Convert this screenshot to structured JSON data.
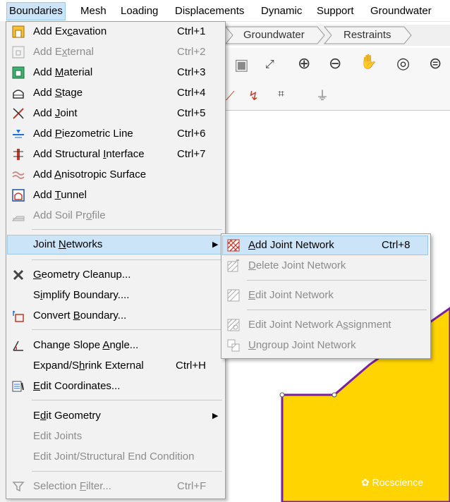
{
  "menubar": {
    "items": [
      "Boundaries",
      "Mesh",
      "Loading",
      "Displacements",
      "Dynamic",
      "Support",
      "Groundwater"
    ]
  },
  "workflow_tabs": [
    "Groundwater",
    "Restraints"
  ],
  "boundaries_menu": {
    "items": [
      {
        "pre": "Add Ex",
        "u": "c",
        "post": "avation",
        "shortcut": "Ctrl+1"
      },
      {
        "pre": "Add E",
        "u": "x",
        "post": "ternal",
        "shortcut": "Ctrl+2"
      },
      {
        "pre": "Add ",
        "u": "M",
        "post": "aterial",
        "shortcut": "Ctrl+3"
      },
      {
        "pre": "Add ",
        "u": "S",
        "post": "tage",
        "shortcut": "Ctrl+4"
      },
      {
        "pre": "Add ",
        "u": "J",
        "post": "oint",
        "shortcut": "Ctrl+5"
      },
      {
        "pre": "Add ",
        "u": "P",
        "post": "iezometric Line",
        "shortcut": "Ctrl+6"
      },
      {
        "pre": "Add Structural ",
        "u": "I",
        "post": "nterface",
        "shortcut": "Ctrl+7"
      },
      {
        "pre": "Add ",
        "u": "A",
        "post": "nisotropic Surface",
        "shortcut": ""
      },
      {
        "pre": "Add ",
        "u": "T",
        "post": "unnel",
        "shortcut": ""
      },
      {
        "pre": "Add Soil Pr",
        "u": "o",
        "post": "file",
        "shortcut": ""
      },
      {
        "pre": "Joint ",
        "u": "N",
        "post": "etworks",
        "shortcut": ""
      },
      {
        "pre": "",
        "u": "G",
        "post": "eometry Cleanup...",
        "shortcut": ""
      },
      {
        "pre": "S",
        "u": "i",
        "post": "mplify Boundary....",
        "shortcut": ""
      },
      {
        "pre": "Convert ",
        "u": "B",
        "post": "oundary...",
        "shortcut": ""
      },
      {
        "pre": "Change Slope ",
        "u": "A",
        "post": "ngle...",
        "shortcut": ""
      },
      {
        "pre": "Expand/S",
        "u": "h",
        "post": "rink External",
        "shortcut": "Ctrl+H"
      },
      {
        "pre": "",
        "u": "E",
        "post": "dit Coordinates...",
        "shortcut": ""
      },
      {
        "pre": "E",
        "u": "d",
        "post": "it Geometry",
        "shortcut": ""
      },
      {
        "pre": "Edit Joints",
        "u": "",
        "post": "",
        "shortcut": ""
      },
      {
        "pre": "Edit Joint/Structural End Condition",
        "u": "",
        "post": "",
        "shortcut": ""
      },
      {
        "pre": "Selection ",
        "u": "F",
        "post": "ilter...",
        "shortcut": "Ctrl+F"
      }
    ]
  },
  "joint_networks_submenu": {
    "items": [
      {
        "pre": "",
        "u": "A",
        "post": "dd Joint Network",
        "shortcut": "Ctrl+8"
      },
      {
        "pre": "",
        "u": "D",
        "post": "elete Joint Network",
        "shortcut": ""
      },
      {
        "pre": "",
        "u": "E",
        "post": "dit Joint Network",
        "shortcut": ""
      },
      {
        "pre": "Edit Joint Network A",
        "u": "s",
        "post": "signment",
        "shortcut": ""
      },
      {
        "pre": "",
        "u": "U",
        "post": "ngroup Joint Network",
        "shortcut": ""
      }
    ]
  },
  "watermark": "Rocscience",
  "colors": {
    "highlight": "#cce4f7",
    "material": "#ffd400",
    "boundary": "#7b1fa2",
    "menu_bg": "#f2f2f2",
    "disabled": "#8c8c8c"
  }
}
